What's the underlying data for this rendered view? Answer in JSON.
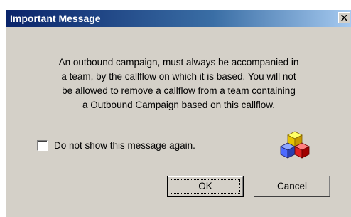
{
  "dialog": {
    "title": "Important Message",
    "close_label": "X",
    "message_lines": [
      "An outbound campaign, must always be accompanied in",
      "a team, by the callflow on which it is based. You will not",
      "be allowed to remove a callflow from a team containing",
      "a Outbound Campaign based on this callflow."
    ],
    "checkbox": {
      "label": "Do not show this message again.",
      "checked": false
    },
    "icon": "colored-cubes-icon",
    "buttons": {
      "ok_label": "OK",
      "cancel_label": "Cancel"
    }
  },
  "colors": {
    "titlebar": "#0a246a",
    "panel": "#d4d0c8"
  }
}
